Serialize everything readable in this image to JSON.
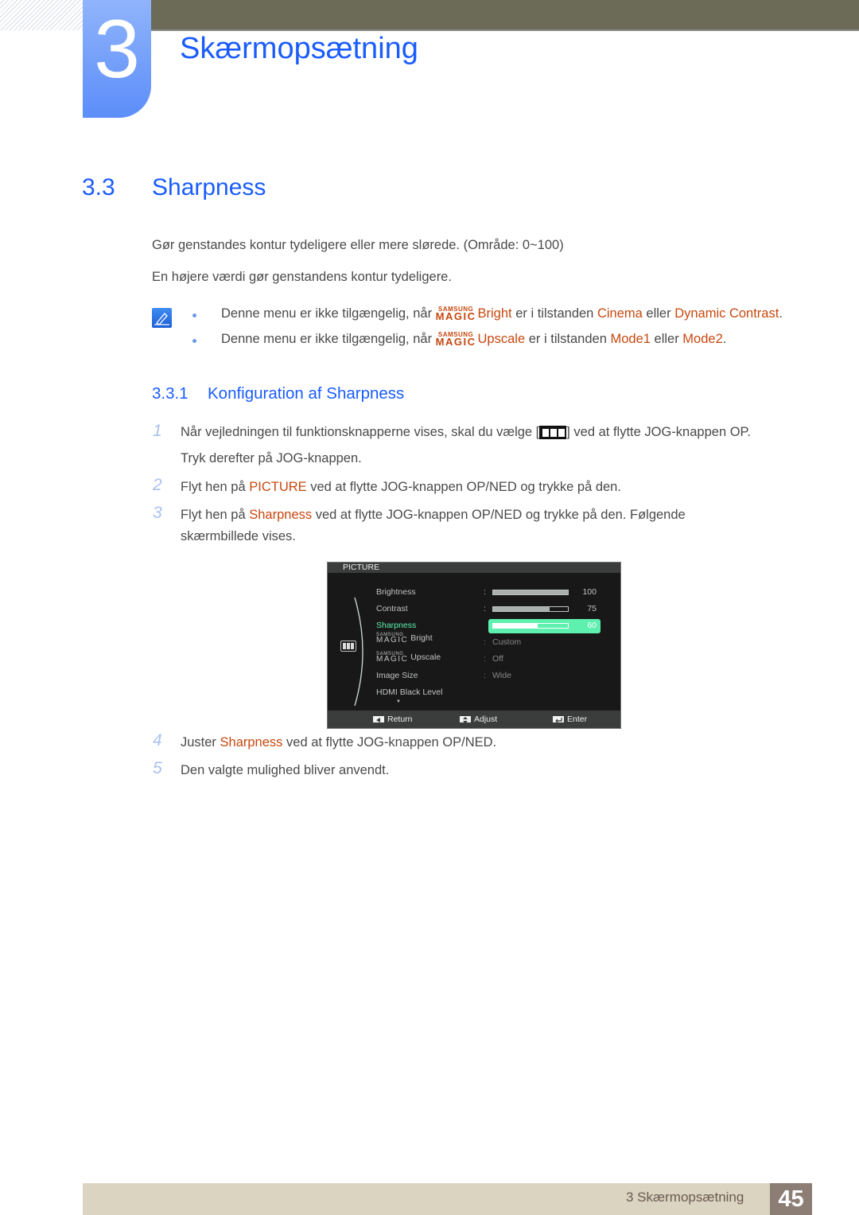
{
  "header": {
    "chapter_number": "3",
    "chapter_title": "Skærmopsætning"
  },
  "section": {
    "number": "3.3",
    "title": "Sharpness",
    "intro": [
      "Gør genstandes kontur tydeligere eller mere slørede. (Område: 0~100)",
      "En højere værdi gør genstandens kontur tydeligere."
    ],
    "notes": [
      {
        "prefix": "Denne menu er ikke tilgængelig, når",
        "brand_small": "SAMSUNG",
        "brand_big": "MAGIC",
        "feature": "Bright",
        "middle": "er i tilstanden",
        "mode1": "Cinema",
        "joiner": "eller",
        "mode2": "Dynamic Contrast",
        "end": "."
      },
      {
        "prefix": "Denne menu er ikke tilgængelig, når",
        "brand_small": "SAMSUNG",
        "brand_big": "MAGIC",
        "feature": "Upscale",
        "middle": "er i tilstanden",
        "mode1": "Mode1",
        "joiner": "eller",
        "mode2": "Mode2",
        "end": "."
      }
    ]
  },
  "subsection": {
    "number": "3.3.1",
    "title": "Konfiguration af Sharpness",
    "steps": [
      {
        "n": "1",
        "a": "Når vejledningen til funktionsknapperne vises, skal du vælge [",
        "b": "] ved at flytte JOG-knappen OP.",
        "c": "Tryk derefter på JOG-knappen."
      },
      {
        "n": "2",
        "a": "Flyt hen på",
        "hl": "PICTURE",
        "b": "ved at flytte JOG-knappen OP/NED og trykke på den."
      },
      {
        "n": "3",
        "a": "Flyt hen på",
        "hl": "Sharpness",
        "b": "ved at flytte JOG-knappen OP/NED og trykke på den. Følgende",
        "c": "skærmbillede vises."
      },
      {
        "n": "4",
        "a": "Juster",
        "hl": "Sharpness",
        "b": "ved at flytte JOG-knappen OP/NED."
      },
      {
        "n": "5",
        "a": "Den valgte mulighed bliver anvendt."
      }
    ]
  },
  "osd": {
    "title": "PICTURE",
    "items": [
      {
        "label": "Brightness",
        "value": "100",
        "fraction": 1.0
      },
      {
        "label": "Contrast",
        "value": "75",
        "fraction": 0.75
      },
      {
        "label": "Sharpness",
        "value": "60",
        "fraction": 0.6,
        "selected": true
      },
      {
        "brand_small": "SAMSUNG",
        "brand_big": "MAGIC",
        "label": "Bright",
        "value": "Custom"
      },
      {
        "brand_small": "SAMSUNG",
        "brand_big": "MAGIC",
        "label": "Upscale",
        "value": "Off"
      },
      {
        "label": "Image Size",
        "value": "Wide"
      },
      {
        "label": "HDMI Black Level"
      }
    ],
    "more_arrow": "▼",
    "footer": {
      "return": "Return",
      "adjust": "Adjust",
      "enter": "Enter"
    },
    "selected_color": "#5ef0ae"
  },
  "footer": {
    "chapter": "3 Skærmopsætning",
    "page": "45"
  },
  "colors": {
    "heading": "#1a5cff",
    "highlight": "#c7480f",
    "topbar": "#6c6b58",
    "footer": "#dbd4c0",
    "page_box": "#8c7d75"
  }
}
